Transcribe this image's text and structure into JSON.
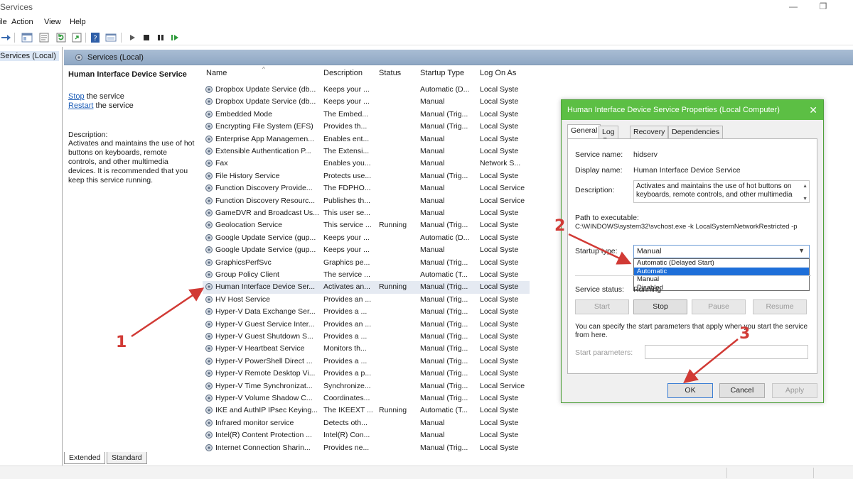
{
  "window": {
    "title": "Services"
  },
  "menu": [
    "File",
    "Action",
    "View",
    "Help"
  ],
  "tree": {
    "item": "Services (Local)"
  },
  "main_header": {
    "title": "Services (Local)"
  },
  "desc_pane": {
    "title": "Human Interface Device Service",
    "stop_link": "Stop",
    "stop_rest": " the service",
    "restart_link": "Restart",
    "restart_rest": " the service",
    "description_label": "Description:",
    "description": "Activates and maintains the use of hot buttons on keyboards, remote controls, and other multimedia devices. It is recommended that you keep this service running."
  },
  "columns": [
    "Name",
    "Description",
    "Status",
    "Startup Type",
    "Log On As"
  ],
  "services": [
    {
      "name": "Dropbox Update Service (db...",
      "desc": "Keeps your ...",
      "status": "",
      "startup": "Automatic (D...",
      "logon": "Local Syste"
    },
    {
      "name": "Dropbox Update Service (db...",
      "desc": "Keeps your ...",
      "status": "",
      "startup": "Manual",
      "logon": "Local Syste"
    },
    {
      "name": "Embedded Mode",
      "desc": "The Embed...",
      "status": "",
      "startup": "Manual (Trig...",
      "logon": "Local Syste"
    },
    {
      "name": "Encrypting File System (EFS)",
      "desc": "Provides th...",
      "status": "",
      "startup": "Manual (Trig...",
      "logon": "Local Syste"
    },
    {
      "name": "Enterprise App Managemen...",
      "desc": "Enables ent...",
      "status": "",
      "startup": "Manual",
      "logon": "Local Syste"
    },
    {
      "name": "Extensible Authentication P...",
      "desc": "The Extensi...",
      "status": "",
      "startup": "Manual",
      "logon": "Local Syste"
    },
    {
      "name": "Fax",
      "desc": "Enables you...",
      "status": "",
      "startup": "Manual",
      "logon": "Network S..."
    },
    {
      "name": "File History Service",
      "desc": "Protects use...",
      "status": "",
      "startup": "Manual (Trig...",
      "logon": "Local Syste"
    },
    {
      "name": "Function Discovery Provide...",
      "desc": "The FDPHO...",
      "status": "",
      "startup": "Manual",
      "logon": "Local Service"
    },
    {
      "name": "Function Discovery Resourc...",
      "desc": "Publishes th...",
      "status": "",
      "startup": "Manual",
      "logon": "Local Service"
    },
    {
      "name": "GameDVR and Broadcast Us...",
      "desc": "This user se...",
      "status": "",
      "startup": "Manual",
      "logon": "Local Syste"
    },
    {
      "name": "Geolocation Service",
      "desc": "This service ...",
      "status": "Running",
      "startup": "Manual (Trig...",
      "logon": "Local Syste"
    },
    {
      "name": "Google Update Service (gup...",
      "desc": "Keeps your ...",
      "status": "",
      "startup": "Automatic (D...",
      "logon": "Local Syste"
    },
    {
      "name": "Google Update Service (gup...",
      "desc": "Keeps your ...",
      "status": "",
      "startup": "Manual",
      "logon": "Local Syste"
    },
    {
      "name": "GraphicsPerfSvc",
      "desc": "Graphics pe...",
      "status": "",
      "startup": "Manual (Trig...",
      "logon": "Local Syste"
    },
    {
      "name": "Group Policy Client",
      "desc": "The service ...",
      "status": "",
      "startup": "Automatic (T...",
      "logon": "Local Syste"
    },
    {
      "name": "Human Interface Device Ser...",
      "desc": "Activates an...",
      "status": "Running",
      "startup": "Manual (Trig...",
      "logon": "Local Syste",
      "selected": true
    },
    {
      "name": "HV Host Service",
      "desc": "Provides an ...",
      "status": "",
      "startup": "Manual (Trig...",
      "logon": "Local Syste"
    },
    {
      "name": "Hyper-V Data Exchange Ser...",
      "desc": "Provides a ...",
      "status": "",
      "startup": "Manual (Trig...",
      "logon": "Local Syste"
    },
    {
      "name": "Hyper-V Guest Service Inter...",
      "desc": "Provides an ...",
      "status": "",
      "startup": "Manual (Trig...",
      "logon": "Local Syste"
    },
    {
      "name": "Hyper-V Guest Shutdown S...",
      "desc": "Provides a ...",
      "status": "",
      "startup": "Manual (Trig...",
      "logon": "Local Syste"
    },
    {
      "name": "Hyper-V Heartbeat Service",
      "desc": "Monitors th...",
      "status": "",
      "startup": "Manual (Trig...",
      "logon": "Local Syste"
    },
    {
      "name": "Hyper-V PowerShell Direct ...",
      "desc": "Provides a ...",
      "status": "",
      "startup": "Manual (Trig...",
      "logon": "Local Syste"
    },
    {
      "name": "Hyper-V Remote Desktop Vi...",
      "desc": "Provides a p...",
      "status": "",
      "startup": "Manual (Trig...",
      "logon": "Local Syste"
    },
    {
      "name": "Hyper-V Time Synchronizat...",
      "desc": "Synchronize...",
      "status": "",
      "startup": "Manual (Trig...",
      "logon": "Local Service"
    },
    {
      "name": "Hyper-V Volume Shadow C...",
      "desc": "Coordinates...",
      "status": "",
      "startup": "Manual (Trig...",
      "logon": "Local Syste"
    },
    {
      "name": "IKE and AuthIP IPsec Keying...",
      "desc": "The IKEEXT ...",
      "status": "Running",
      "startup": "Automatic (T...",
      "logon": "Local Syste"
    },
    {
      "name": "Infrared monitor service",
      "desc": "Detects oth...",
      "status": "",
      "startup": "Manual",
      "logon": "Local Syste"
    },
    {
      "name": "Intel(R) Content Protection ...",
      "desc": "Intel(R) Con...",
      "status": "",
      "startup": "Manual",
      "logon": "Local Syste"
    },
    {
      "name": "Internet Connection Sharin...",
      "desc": "Provides ne...",
      "status": "",
      "startup": "Manual (Trig...",
      "logon": "Local Syste"
    }
  ],
  "bottom_tabs": [
    "Extended",
    "Standard"
  ],
  "dialog": {
    "title": "Human Interface Device Service Properties (Local Computer)",
    "tabs": [
      "General",
      "Log On",
      "Recovery",
      "Dependencies"
    ],
    "service_name_label": "Service name:",
    "service_name": "hidserv",
    "display_name_label": "Display name:",
    "display_name": "Human Interface Device Service",
    "description_label": "Description:",
    "description": "Activates and maintains the use of hot buttons on keyboards, remote controls, and other multimedia",
    "path_label": "Path to executable:",
    "path": "C:\\WINDOWS\\system32\\svchost.exe -k LocalSystemNetworkRestricted -p",
    "startup_label": "Startup type:",
    "startup_value": "Manual",
    "startup_options": [
      "Automatic (Delayed Start)",
      "Automatic",
      "Manual",
      "Disabled"
    ],
    "status_label": "Service status:",
    "status_value": "Running",
    "btn_start": "Start",
    "btn_stop": "Stop",
    "btn_pause": "Pause",
    "btn_resume": "Resume",
    "params_note": "You can specify the start parameters that apply when you start the service from here.",
    "params_label": "Start parameters:",
    "btn_ok": "OK",
    "btn_cancel": "Cancel",
    "btn_apply": "Apply"
  },
  "annotations": [
    "1",
    "2",
    "3"
  ],
  "colors": {
    "accent_green": "#5cbf44",
    "annotation_red": "#d13a35",
    "highlight_blue": "#1e6fd9"
  }
}
